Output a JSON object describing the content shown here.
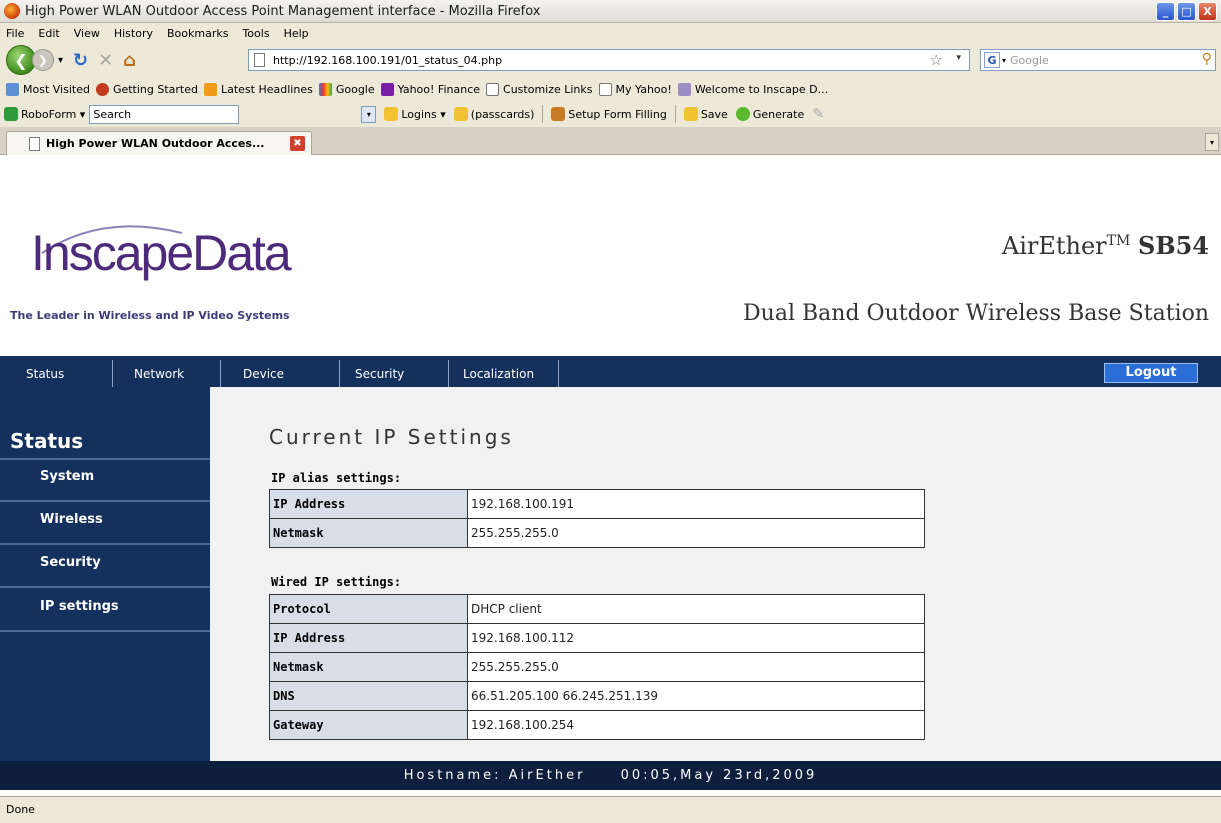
{
  "window": {
    "title": "High Power WLAN Outdoor Access Point Management interface - Mozilla Firefox",
    "minimize_glyph": "_",
    "maximize_glyph": "□",
    "close_glyph": "X"
  },
  "menu": [
    "File",
    "Edit",
    "View",
    "History",
    "Bookmarks",
    "Tools",
    "Help"
  ],
  "nav": {
    "url": "http://192.168.100.191/01_status_04.php",
    "search_placeholder": "Google"
  },
  "bookmarks": [
    "Most Visited",
    "Getting Started",
    "Latest Headlines",
    "Google",
    "Yahoo! Finance",
    "Customize Links",
    "My Yahoo!",
    "Welcome to Inscape D..."
  ],
  "roboform": {
    "label": "RoboForm",
    "search_value": "Search",
    "logins": "Logins",
    "passcards": "(passcards)",
    "setup": "Setup Form Filling",
    "save": "Save",
    "generate": "Generate"
  },
  "tab": {
    "title": "High Power WLAN Outdoor Acces..."
  },
  "header": {
    "logo": "InscapeData",
    "tagline": "The Leader in Wireless and IP Video Systems",
    "product_name": "AirEther",
    "product_tm": "TM",
    "product_model": "SB54",
    "product_sub": "Dual Band Outdoor Wireless Base Station"
  },
  "topnav": [
    "Status",
    "Network",
    "Device",
    "Security",
    "Localization"
  ],
  "logout_label": "Logout",
  "sidebar": {
    "title": "Status",
    "items": [
      "System",
      "Wireless",
      "Security",
      "IP settings"
    ]
  },
  "main": {
    "heading": "Current IP Settings",
    "alias_label": "IP alias settings:",
    "alias_rows": [
      {
        "key": "IP Address",
        "value": "192.168.100.191"
      },
      {
        "key": "Netmask",
        "value": "255.255.255.0"
      }
    ],
    "wired_label": "Wired IP settings:",
    "wired_rows": [
      {
        "key": "Protocol",
        "value": "DHCP client"
      },
      {
        "key": "IP Address",
        "value": "192.168.100.112"
      },
      {
        "key": "Netmask",
        "value": "255.255.255.0"
      },
      {
        "key": "DNS",
        "value": "66.51.205.100 66.245.251.139"
      },
      {
        "key": "Gateway",
        "value": "192.168.100.254"
      }
    ]
  },
  "footer": {
    "hostname": "Hostname: AirEther",
    "datetime": "00:05,May 23rd,2009"
  },
  "status": "Done"
}
